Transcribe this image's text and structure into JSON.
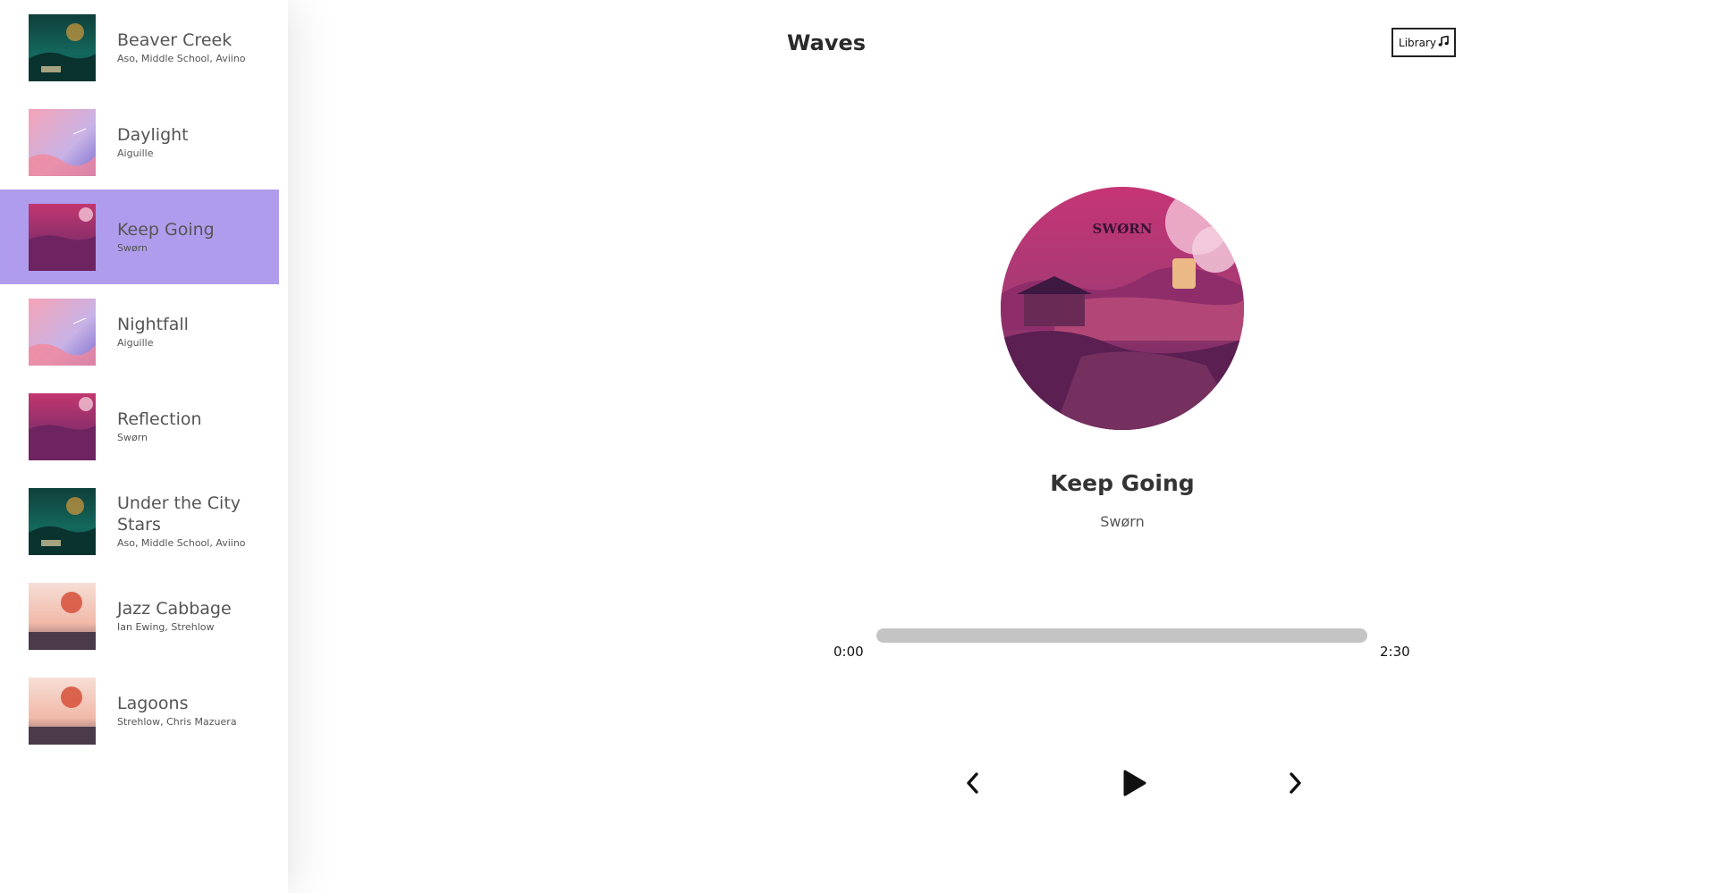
{
  "nav": {
    "title": "Waves",
    "library_button_label": "Library"
  },
  "library": {
    "songs": [
      {
        "name": "Beaver Creek",
        "artist": "Aso, Middle School, Aviino",
        "active": false
      },
      {
        "name": "Daylight",
        "artist": "Aiguille",
        "active": false
      },
      {
        "name": "Keep Going",
        "artist": "Swørn",
        "active": true
      },
      {
        "name": "Nightfall",
        "artist": "Aiguille",
        "active": false
      },
      {
        "name": "Reflection",
        "artist": "Swørn",
        "active": false
      },
      {
        "name": "Under the City Stars",
        "artist": "Aso, Middle School, Aviino",
        "active": false
      },
      {
        "name": "Jazz Cabbage",
        "artist": "Ian Ewing, Strehlow",
        "active": false
      },
      {
        "name": "Lagoons",
        "artist": "Strehlow, Chris Mazuera",
        "active": false
      }
    ]
  },
  "player": {
    "current_song": "Keep Going",
    "current_artist": "Swørn",
    "cover_text": "SWØRN",
    "time_current": "0:00",
    "time_total": "2:30",
    "progress": 0
  },
  "colors": {
    "active_item": "#b09cec",
    "progress_track": "#c4c4c4"
  },
  "icons": {
    "library": "music-note-icon",
    "prev": "chevron-left-icon",
    "play": "play-icon",
    "next": "chevron-right-icon"
  }
}
